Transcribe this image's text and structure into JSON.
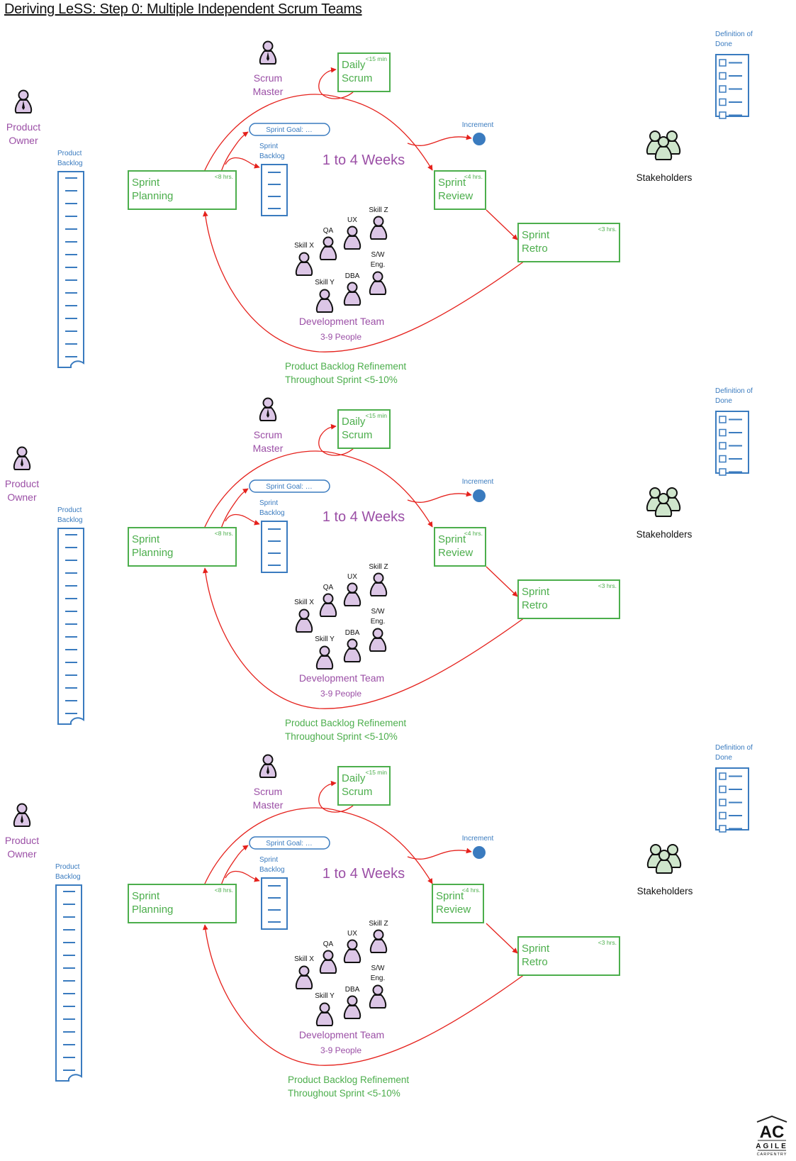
{
  "title": "Deriving LeSS: Step 0: Multiple Independent Scrum Teams",
  "colors": {
    "role_purple": "#9b4fa6",
    "event_green": "#4cae4c",
    "artifact_blue": "#3a7bbf",
    "arrow_red": "#e5211c",
    "person_fill": "#dcc6e6",
    "stakeholder_fill": "#cfe6cc"
  },
  "panels": [
    {
      "product_owner": "Product\nOwner",
      "scrum_master": "Scrum\nMaster",
      "product_backlog": "Product\nBacklog",
      "sprint_goal": "Sprint Goal: …",
      "sprint_backlog": "Sprint\nBacklog",
      "duration": "1 to 4 Weeks",
      "increment": "Increment",
      "stakeholders": "Stakeholders",
      "definition_of_done": "Definition of\nDone",
      "events": {
        "daily_scrum": {
          "label": "Daily\nScrum",
          "timebox": "<15 min"
        },
        "sprint_planning": {
          "label": "Sprint\nPlanning",
          "timebox": "<8 hrs."
        },
        "sprint_review": {
          "label": "Sprint\nReview",
          "timebox": "<4 hrs."
        },
        "sprint_retro": {
          "label": "Sprint\nRetro",
          "timebox": "<3 hrs."
        }
      },
      "team_members": [
        "Skill X",
        "QA",
        "UX",
        "Skill Z",
        "S/W\nEng.",
        "DBA",
        "Skill Y"
      ],
      "development_team": "Development Team",
      "team_size": "3-9 People",
      "refinement": "Product Backlog Refinement\nThroughout Sprint <5-10%"
    },
    {
      "product_owner": "Product\nOwner",
      "scrum_master": "Scrum\nMaster",
      "product_backlog": "Product\nBacklog",
      "sprint_goal": "Sprint Goal: …",
      "sprint_backlog": "Sprint\nBacklog",
      "duration": "1 to 4 Weeks",
      "increment": "Increment",
      "stakeholders": "Stakeholders",
      "definition_of_done": "Definition of\nDone",
      "events": {
        "daily_scrum": {
          "label": "Daily\nScrum",
          "timebox": "<15 min"
        },
        "sprint_planning": {
          "label": "Sprint\nPlanning",
          "timebox": "<8 hrs."
        },
        "sprint_review": {
          "label": "Sprint\nReview",
          "timebox": "<4 hrs."
        },
        "sprint_retro": {
          "label": "Sprint\nRetro",
          "timebox": "<3 hrs."
        }
      },
      "team_members": [
        "Skill X",
        "QA",
        "UX",
        "Skill Z",
        "S/W\nEng.",
        "DBA",
        "Skill Y"
      ],
      "development_team": "Development Team",
      "team_size": "3-9 People",
      "refinement": "Product Backlog Refinement\nThroughout Sprint <5-10%"
    },
    {
      "product_owner": "Product\nOwner",
      "scrum_master": "Scrum\nMaster",
      "product_backlog": "Product\nBacklog",
      "sprint_goal": "Sprint Goal: …",
      "sprint_backlog": "Sprint\nBacklog",
      "duration": "1 to 4 Weeks",
      "increment": "Increment",
      "stakeholders": "Stakeholders",
      "definition_of_done": "Definition of\nDone",
      "events": {
        "daily_scrum": {
          "label": "Daily\nScrum",
          "timebox": "<15 min"
        },
        "sprint_planning": {
          "label": "Sprint\nPlanning",
          "timebox": "<8 hrs."
        },
        "sprint_review": {
          "label": "Sprint\nReview",
          "timebox": "<4 hrs."
        },
        "sprint_retro": {
          "label": "Sprint\nRetro",
          "timebox": "<3 hrs."
        }
      },
      "team_members": [
        "Skill X",
        "QA",
        "UX",
        "Skill Z",
        "S/W\nEng.",
        "DBA",
        "Skill Y"
      ],
      "development_team": "Development Team",
      "team_size": "3-9 People",
      "refinement": "Product Backlog Refinement\nThroughout Sprint <5-10%"
    }
  ],
  "logo": {
    "mark": "AC",
    "line1": "AGILE",
    "line2": "CARPENTRY"
  }
}
